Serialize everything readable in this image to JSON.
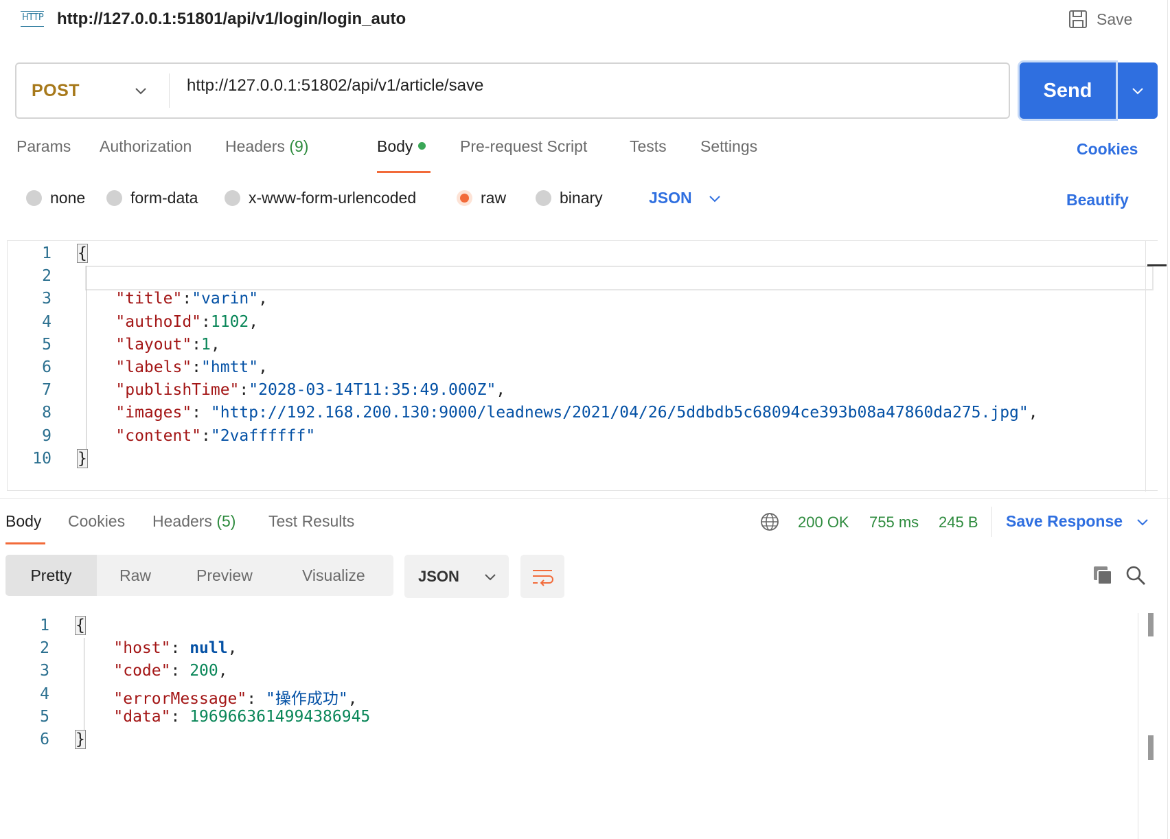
{
  "title_bar": {
    "protocol_label": "HTTP",
    "request_name": "http://127.0.0.1:51801/api/v1/login/login_auto",
    "save_label": "Save"
  },
  "url_bar": {
    "method": "POST",
    "url": "http://127.0.0.1:51802/api/v1/article/save",
    "send_label": "Send"
  },
  "request_tabs": {
    "params": "Params",
    "authorization": "Authorization",
    "headers": "Headers",
    "headers_count": "(9)",
    "body": "Body",
    "pre_request": "Pre-request Script",
    "tests": "Tests",
    "settings": "Settings",
    "cookies": "Cookies"
  },
  "body_types": {
    "none": "none",
    "form_data": "form-data",
    "urlencoded": "x-www-form-urlencoded",
    "raw": "raw",
    "binary": "binary",
    "format": "JSON",
    "beautify": "Beautify",
    "selected": "raw"
  },
  "request_body": {
    "line_numbers": [
      "1",
      "2",
      "3",
      "4",
      "5",
      "6",
      "7",
      "8",
      "9",
      "10"
    ],
    "open_brace": "{",
    "close_brace": "}",
    "fields": [
      {
        "key": "\"title\"",
        "sep": ":",
        "value": "\"varin\"",
        "type": "string",
        "tail": ","
      },
      {
        "key": "\"authoId\"",
        "sep": ":",
        "value": "1102",
        "type": "number",
        "tail": ","
      },
      {
        "key": "\"layout\"",
        "sep": ":",
        "value": "1",
        "type": "number",
        "tail": ","
      },
      {
        "key": "\"labels\"",
        "sep": ":",
        "value": "\"hmtt\"",
        "type": "string",
        "tail": ","
      },
      {
        "key": "\"publishTime\"",
        "sep": ":",
        "value": "\"2028-03-14T11:35:49.000Z\"",
        "type": "string",
        "tail": ","
      },
      {
        "key": "\"images\"",
        "sep": ": ",
        "value": "\"http://192.168.200.130:9000/leadnews/2021/04/26/5ddbdb5c68094ce393b08a47860da275.jpg\"",
        "type": "string",
        "tail": ","
      },
      {
        "key": "\"content\"",
        "sep": ":",
        "value": "\"2vaffffff\"",
        "type": "string",
        "tail": ""
      }
    ]
  },
  "response_tabs": {
    "body": "Body",
    "cookies": "Cookies",
    "headers": "Headers",
    "headers_count": "(5)",
    "test_results": "Test Results"
  },
  "response_status": {
    "status": "200 OK",
    "time": "755 ms",
    "size": "245 B",
    "save_response": "Save Response"
  },
  "response_view": {
    "pretty": "Pretty",
    "raw": "Raw",
    "preview": "Preview",
    "visualize": "Visualize",
    "format": "JSON"
  },
  "response_body": {
    "line_numbers": [
      "1",
      "2",
      "3",
      "4",
      "5",
      "6"
    ],
    "open_brace": "{",
    "close_brace": "}",
    "fields": [
      {
        "key": "\"host\"",
        "sep": ": ",
        "value": "null",
        "type": "keyword",
        "tail": ","
      },
      {
        "key": "\"code\"",
        "sep": ": ",
        "value": "200",
        "type": "number",
        "tail": ","
      },
      {
        "key": "\"errorMessage\"",
        "sep": ": ",
        "value": "\"操作成功\"",
        "type": "string",
        "tail": ","
      },
      {
        "key": "\"data\"",
        "sep": ": ",
        "value": "1969663614994386945",
        "type": "number",
        "tail": ""
      }
    ]
  },
  "colors": {
    "accent": "#2f6fe0",
    "tab_active": "#f26b3a",
    "method": "#a7791b",
    "success": "#2e8b3e"
  }
}
